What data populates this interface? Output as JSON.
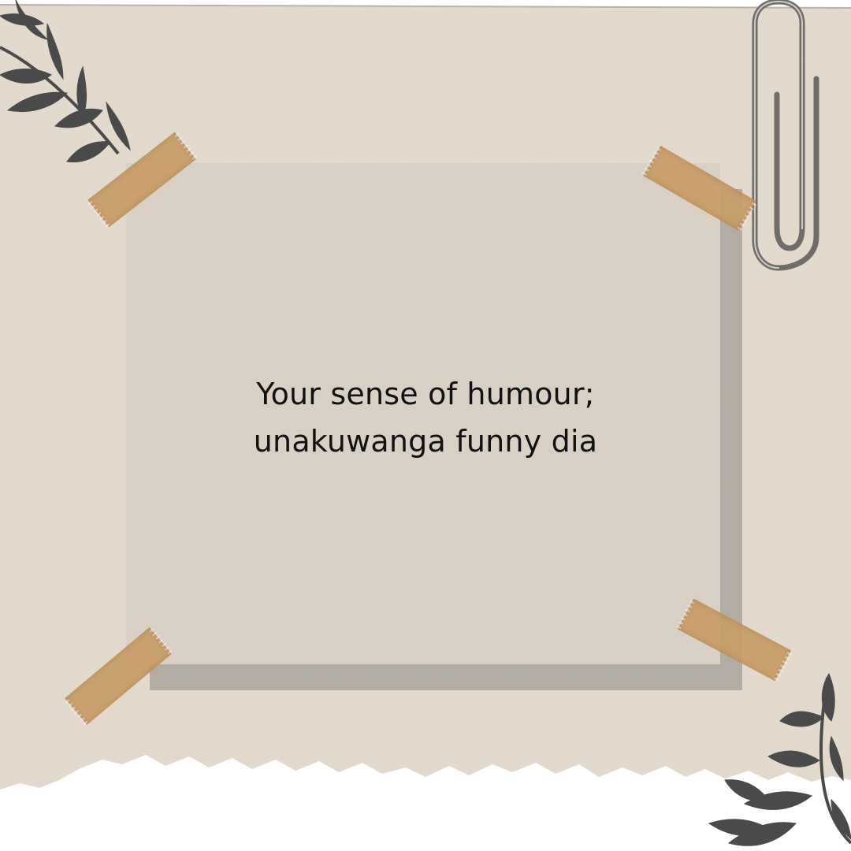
{
  "note": {
    "line1": "Your sense of humour;",
    "line2": "unakuwanga funny dia"
  },
  "colors": {
    "paper": "#e6ddd0",
    "note": "#d8d0c4",
    "tape": "#c99e68",
    "leaf": "#4a4a4a",
    "text": "#111111"
  },
  "icons": {
    "top_right": "paperclip-icon",
    "top_left": "leaf-branch-icon",
    "bottom_right": "leaf-branch-icon"
  }
}
